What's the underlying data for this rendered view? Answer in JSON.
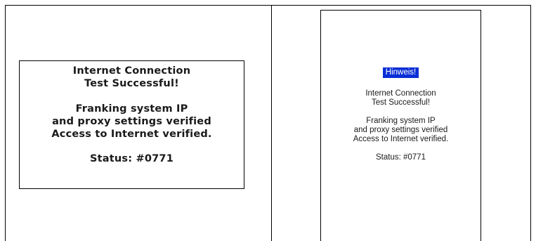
{
  "left_display": {
    "line1": "Internet Connection",
    "line2": "Test Successful!",
    "line3": "Franking system IP",
    "line4": "and proxy settings verified",
    "line5": "Access to Internet verified.",
    "status": "Status: #0771"
  },
  "right_display": {
    "badge": "Hinweis!",
    "line1": "Internet Connection",
    "line2": "Test Successful!",
    "line3": "Franking system IP",
    "line4": "and proxy settings verified",
    "line5": "Access to Internet verified.",
    "status": "Status: #0771"
  },
  "colors": {
    "badge_background": "#0a2fd6",
    "badge_text": "#ffffff",
    "border": "#000000"
  }
}
